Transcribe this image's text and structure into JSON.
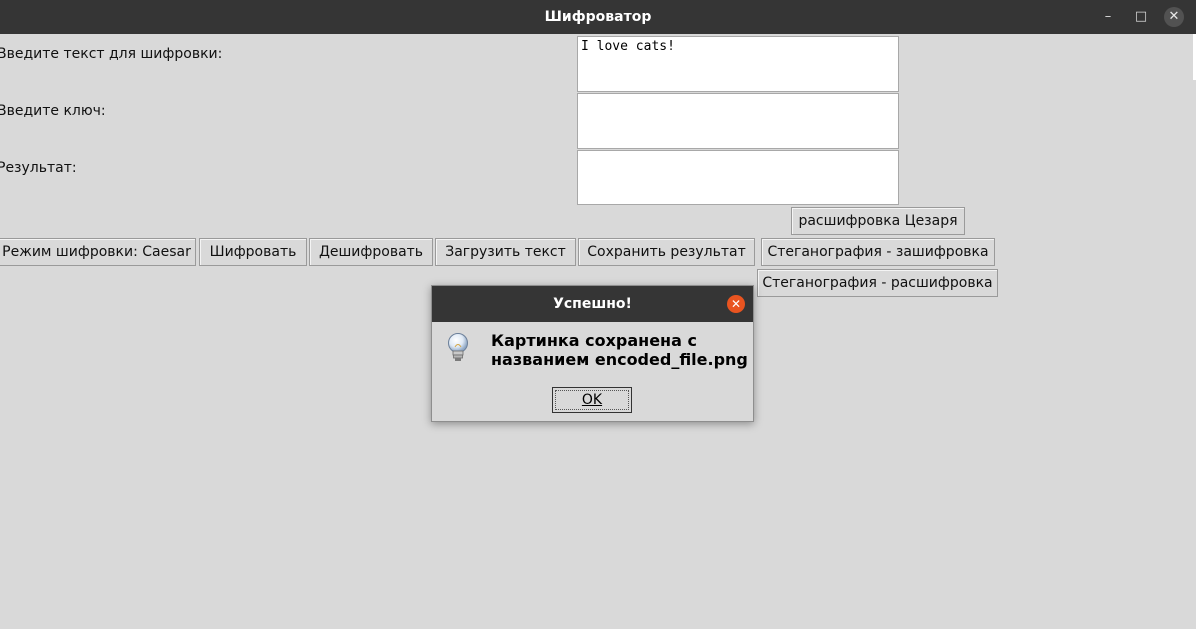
{
  "window": {
    "title": "Шифроватор",
    "controls": {
      "minimize_icon": "–",
      "maximize_icon": "□",
      "close_icon": "✕"
    }
  },
  "form": {
    "input_label": "Введите текст для шифровки:",
    "input_value": "I love cats!",
    "key_label": "Введите ключ:",
    "key_value": "",
    "result_label": "Результат:",
    "result_value": ""
  },
  "buttons": {
    "caesar_decode": "расшифровка Цезаря",
    "mode": "Режим шифровки: Caesar",
    "encrypt": "Шифровать",
    "decrypt": "Дешифровать",
    "load_text": "Загрузить текст",
    "save_result": "Сохранить результат",
    "stego_encode": "Стеганография - зашифровка",
    "stego_decode": "Стеганография - расшифровка"
  },
  "dialog": {
    "title": "Успешно!",
    "message": "Картинка сохранена с названием encoded_file.png",
    "ok_label": "OK",
    "icon": "lightbulb-icon",
    "close_color": "#e95420"
  }
}
